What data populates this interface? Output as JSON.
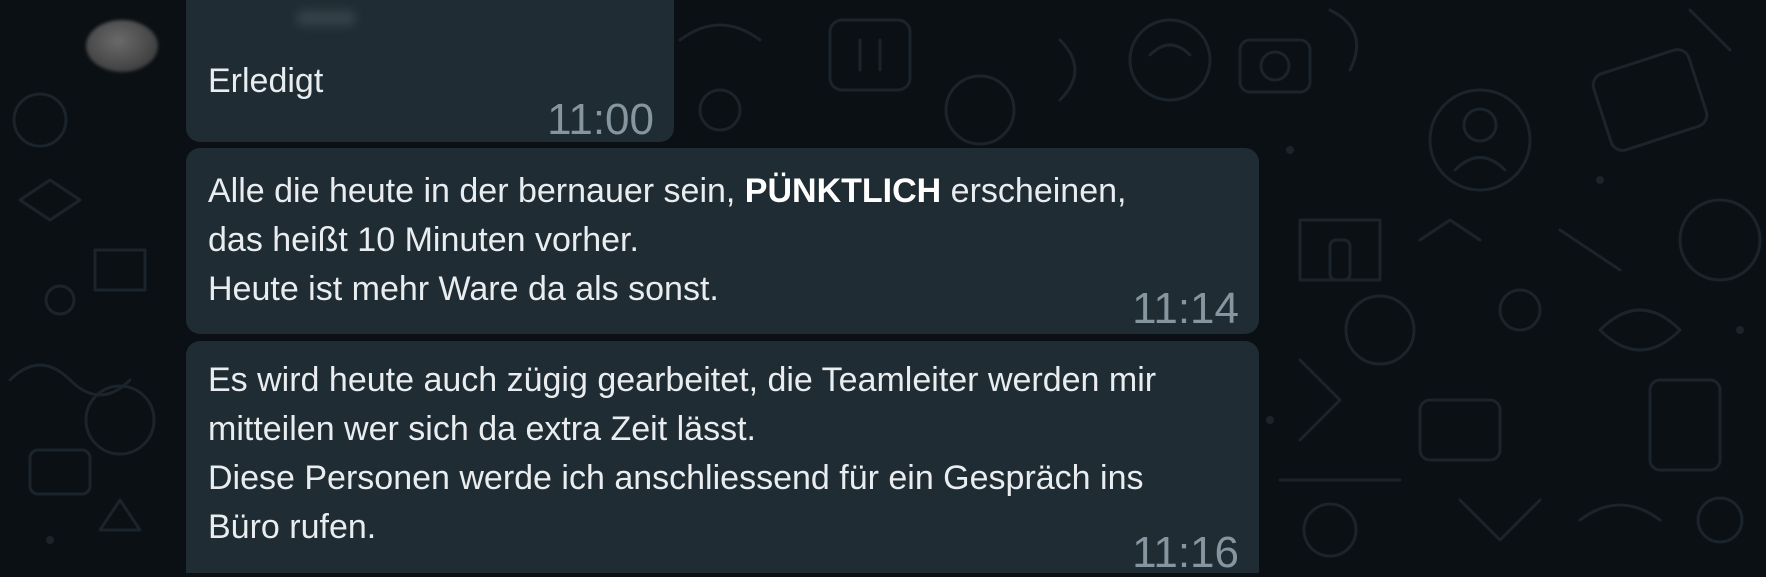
{
  "chat": {
    "messages": [
      {
        "text": "Erledigt",
        "time": "11:00"
      },
      {
        "line1_before": "Alle die heute in der bernauer sein, ",
        "line1_bold": "PÜNKTLICH",
        "line1_after": " erscheinen,",
        "line2": "das heißt 10 Minuten vorher.",
        "line3": "Heute ist mehr Ware da als sonst.",
        "time": "11:14"
      },
      {
        "line1": "Es wird heute auch zügig gearbeitet, die Teamleiter werden mir",
        "line2": "mitteilen wer sich da extra Zeit lässt.",
        "line3": "Diese Personen werde ich anschliessend für ein Gespräch ins",
        "line4": "Büro rufen.",
        "time": "11:16"
      }
    ]
  },
  "colors": {
    "background": "#0b1014",
    "bubble": "#1f2c33",
    "text": "#e9edef",
    "timestamp": "#8696a0"
  }
}
